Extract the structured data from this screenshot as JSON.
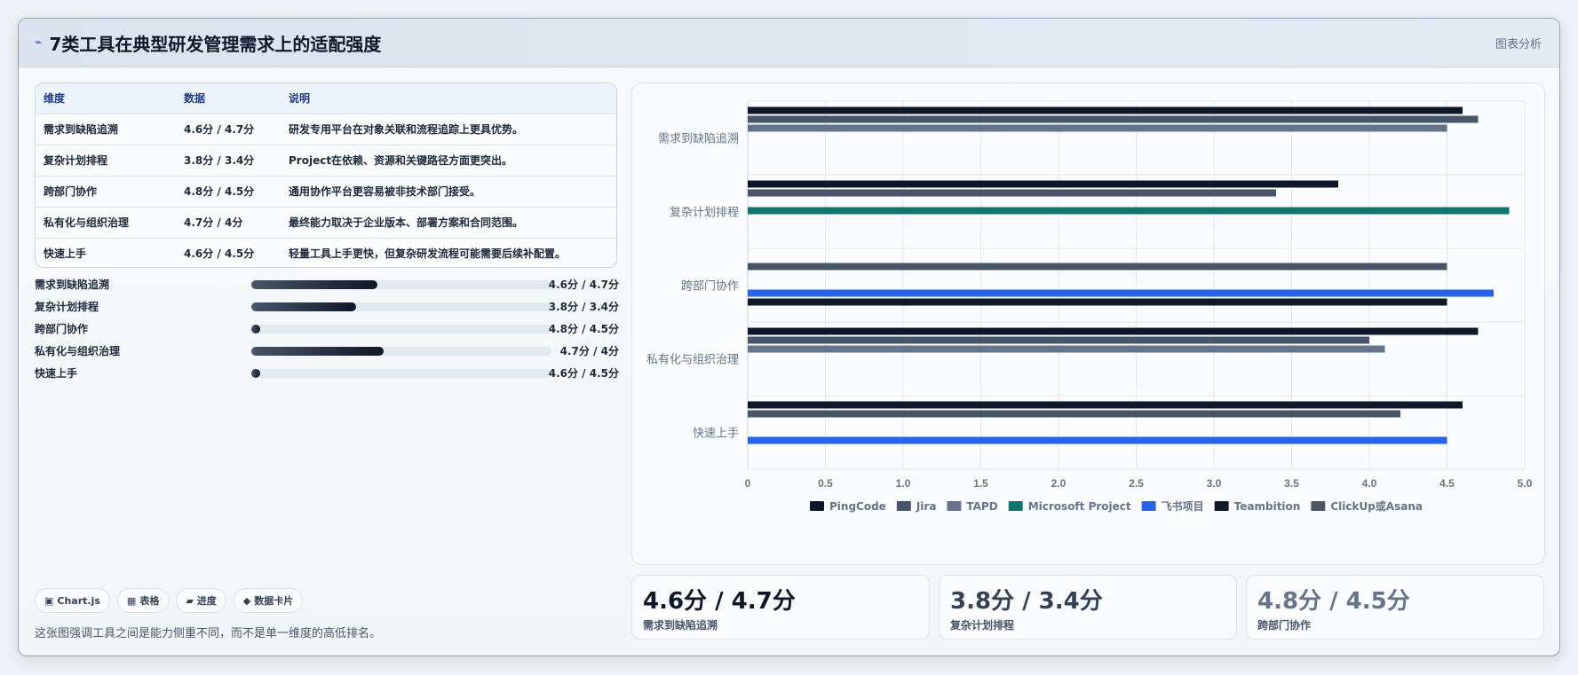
{
  "header": {
    "icon": "bolt-icon",
    "title": "7类工具在典型研发管理需求上的适配强度",
    "link": "图表分析"
  },
  "table": {
    "headers": [
      "维度",
      "数据",
      "说明"
    ],
    "rows": [
      [
        "需求到缺陷追溯",
        "4.6分 / 4.7分",
        "研发专用平台在对象关联和流程追踪上更具优势。"
      ],
      [
        "复杂计划排程",
        "3.8分 / 3.4分",
        "Project在依赖、资源和关键路径方面更突出。"
      ],
      [
        "跨部门协作",
        "4.8分 / 4.5分",
        "通用协作平台更容易被非技术部门接受。"
      ],
      [
        "私有化与组织治理",
        "4.7分 / 4分",
        "最终能力取决于企业版本、部署方案和合同范围。"
      ],
      [
        "快速上手",
        "4.6分 / 4.5分",
        "轻量工具上手更快，但复杂研发流程可能需要后续补配置。"
      ]
    ]
  },
  "progress": [
    {
      "label": "需求到缺陷追溯",
      "value": "4.6分 / 4.7分",
      "fraction": 0.42
    },
    {
      "label": "复杂计划排程",
      "value": "3.8分 / 3.4分",
      "fraction": 0.35
    },
    {
      "label": "跨部门协作",
      "value": "4.8分 / 4.5分",
      "fraction": 0.03
    },
    {
      "label": "私有化与组织治理",
      "value": "4.7分 / 4分",
      "fraction": 0.44
    },
    {
      "label": "快速上手",
      "value": "4.6分 / 4.5分",
      "fraction": 0.03
    }
  ],
  "chips": [
    {
      "icon": "▣",
      "label": "Chart.js"
    },
    {
      "icon": "▦",
      "label": "表格"
    },
    {
      "icon": "▰",
      "label": "进度"
    },
    {
      "icon": "◆",
      "label": "数据卡片"
    }
  ],
  "caption": "这张图强调工具之间是能力侧重不同，而不是单一维度的高低排名。",
  "stats": [
    {
      "value": "4.6分 / 4.7分",
      "label": "需求到缺陷追溯",
      "color": "#0f172a"
    },
    {
      "value": "3.8分 / 3.4分",
      "label": "复杂计划排程",
      "color": "#334155"
    },
    {
      "value": "4.8分 / 4.5分",
      "label": "跨部门协作",
      "color": "#64748b"
    }
  ],
  "chart_data": {
    "type": "bar",
    "orientation": "horizontal",
    "categories": [
      "需求到缺陷追溯",
      "复杂计划排程",
      "跨部门协作",
      "私有化与组织治理",
      "快速上手"
    ],
    "xlim": [
      0,
      5.0
    ],
    "x_ticks": [
      "0",
      "0.5",
      "1.0",
      "1.5",
      "2.0",
      "2.5",
      "3.0",
      "3.5",
      "4.0",
      "4.5",
      "5.0"
    ],
    "grid": true,
    "legend_position": "bottom",
    "series": [
      {
        "name": "PingCode",
        "color": "#0f172a",
        "values": [
          4.6,
          3.8,
          null,
          4.7,
          4.6
        ]
      },
      {
        "name": "Jira",
        "color": "#475569",
        "values": [
          4.7,
          3.4,
          4.5,
          4.0,
          4.2
        ]
      },
      {
        "name": "TAPD",
        "color": "#64748b",
        "values": [
          4.5,
          null,
          null,
          4.1,
          null
        ]
      },
      {
        "name": "Microsoft Project",
        "color": "#0f766e",
        "values": [
          null,
          4.9,
          null,
          null,
          null
        ]
      },
      {
        "name": "飞书项目",
        "color": "#2563eb",
        "values": [
          null,
          null,
          4.8,
          null,
          4.5
        ]
      },
      {
        "name": "Teambition",
        "color": "#111827",
        "values": [
          null,
          null,
          4.5,
          null,
          null
        ]
      },
      {
        "name": "ClickUp或Asana",
        "color": "#4b5563",
        "values": [
          null,
          null,
          null,
          null,
          null
        ]
      }
    ]
  }
}
